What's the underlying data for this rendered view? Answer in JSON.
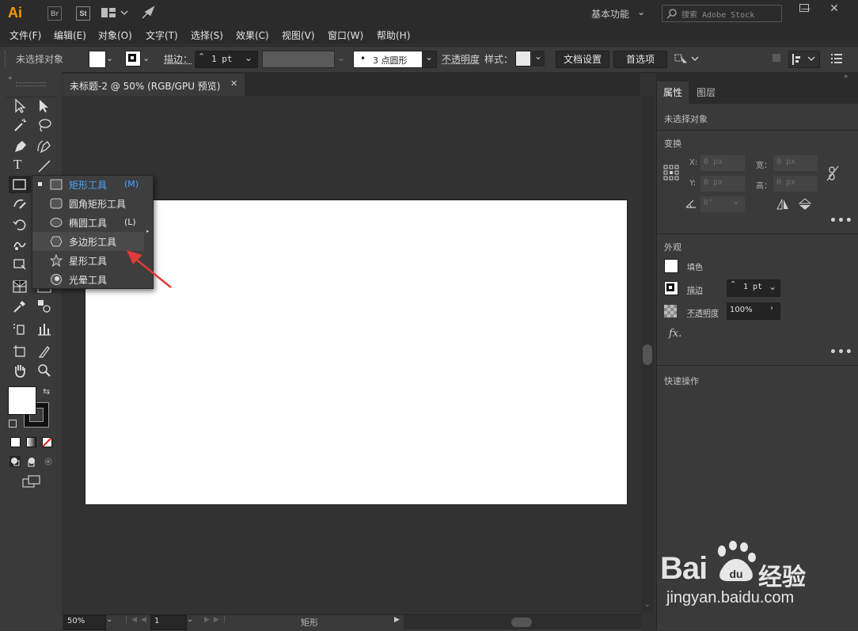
{
  "app": {
    "logo": "Ai",
    "bridge_label": "Br",
    "stock_label": "St",
    "workspace": "基本功能",
    "search_placeholder": "搜索 Adobe Stock"
  },
  "menu": [
    "文件(F)",
    "编辑(E)",
    "对象(O)",
    "文字(T)",
    "选择(S)",
    "效果(C)",
    "视图(V)",
    "窗口(W)",
    "帮助(H)"
  ],
  "control_bar": {
    "selection": "未选择对象",
    "stroke_label": "描边：",
    "stroke_value": "1 pt",
    "brush_value": "3 点圆形",
    "brush_dot": "•",
    "opacity_label": "不透明度",
    "style_label": "样式：",
    "doc_setup_button": "文档设置",
    "preferences_button": "首选项"
  },
  "document": {
    "tab_title": "未标题-2 @ 50% (RGB/GPU 预览)",
    "close": "✕"
  },
  "flyout": {
    "items": [
      {
        "label": "矩形工具",
        "key": "(M)",
        "icon": "rectangle-icon",
        "active": true
      },
      {
        "label": "圆角矩形工具",
        "key": "",
        "icon": "rounded-rectangle-icon",
        "active": false
      },
      {
        "label": "椭圆工具",
        "key": "(L)",
        "icon": "ellipse-icon",
        "active": false
      },
      {
        "label": "多边形工具",
        "key": "",
        "icon": "polygon-icon",
        "active": false
      },
      {
        "label": "星形工具",
        "key": "",
        "icon": "star-icon",
        "active": false
      },
      {
        "label": "光晕工具",
        "key": "",
        "icon": "flare-icon",
        "active": false
      }
    ],
    "active_color": "#4aa3ff",
    "highlight_item": "多边形工具"
  },
  "status_bar": {
    "zoom": "50%",
    "artboard_number": "1",
    "current_tool": "矩形"
  },
  "right_panel": {
    "tabs": [
      "属性",
      "图层"
    ],
    "selection": "未选择对象",
    "transform": {
      "title": "变换",
      "x_label": "X:",
      "x_value": "0 px",
      "y_label": "Y:",
      "y_value": "0 px",
      "w_label": "宽：",
      "w_value": "0 px",
      "h_label": "高：",
      "h_value": "0 px",
      "angle_value": "0°"
    },
    "appearance": {
      "title": "外观",
      "fill_label": "填色",
      "stroke_label": "描边",
      "stroke_value": "1 pt",
      "opacity_label": "不透明度",
      "opacity_value": "100%",
      "fx_label": "fx."
    },
    "quick_actions": {
      "title": "快速操作"
    },
    "more": "•••"
  },
  "watermark": {
    "brand": "Bai",
    "brand_suffix": "经验",
    "url": "jingyan.baidu.com"
  },
  "colors": {
    "app_bg": "#323232",
    "panel_bg": "#3a3a3a",
    "accent": "#4aa3ff",
    "annotation_arrow": "#e03a3a",
    "logo_orange": "#ff9a00"
  }
}
